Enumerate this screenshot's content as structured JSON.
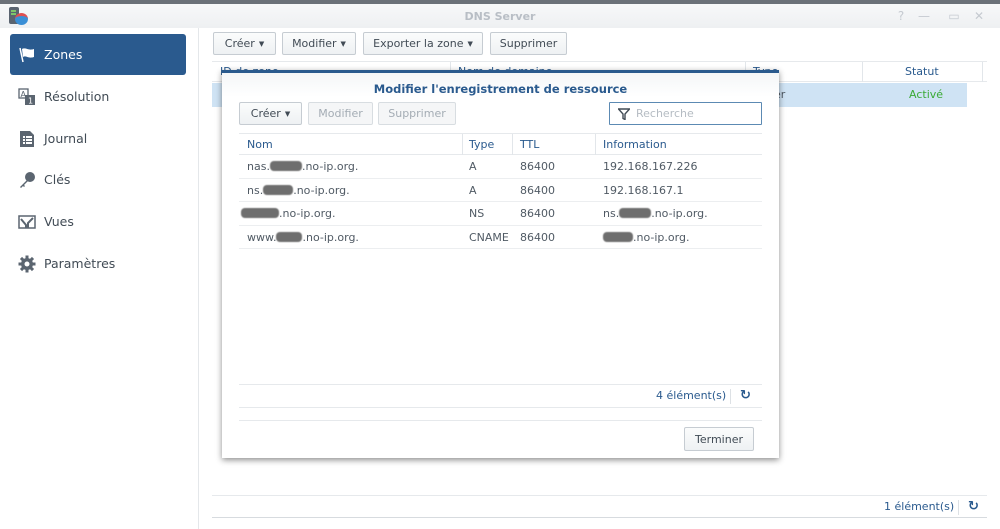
{
  "window": {
    "title": "DNS Server",
    "controls": {
      "help": "?",
      "minimize": "—",
      "maximize": "▭",
      "close": "✕"
    }
  },
  "sidebar": {
    "items": [
      {
        "label": "Zones",
        "icon": "flag-icon",
        "active": true
      },
      {
        "label": "Résolution",
        "icon": "resolution-icon",
        "active": false
      },
      {
        "label": "Journal",
        "icon": "log-icon",
        "active": false
      },
      {
        "label": "Clés",
        "icon": "key-icon",
        "active": false
      },
      {
        "label": "Vues",
        "icon": "views-icon",
        "active": false
      },
      {
        "label": "Paramètres",
        "icon": "gear-icon",
        "active": false
      }
    ]
  },
  "toolbar": {
    "create": "Créer",
    "modify": "Modifier",
    "export": "Exporter la zone",
    "delete": "Supprimer"
  },
  "zones_grid": {
    "columns": [
      "ID de zone",
      "Nom de domaine",
      "Type",
      "Statut"
    ],
    "rows": [
      {
        "type_partial": "er",
        "status": "Activé"
      }
    ],
    "status_color": "#3aaa35",
    "footer_count": "1 élément(s)"
  },
  "dialog": {
    "title": "Modifier l'enregistrement de ressource",
    "buttons": {
      "create": "Créer",
      "modify": "Modifier",
      "delete": "Supprimer"
    },
    "search_placeholder": "Recherche",
    "columns": [
      "Nom",
      "Type",
      "TTL",
      "Information"
    ],
    "records": [
      {
        "name_prefix": "nas.",
        "name_suffix": ".no-ip.org.",
        "type": "A",
        "ttl": "86400",
        "info_prefix": "192.168.167.226",
        "info_suffix": ""
      },
      {
        "name_prefix": "ns.",
        "name_suffix": ".no-ip.org.",
        "type": "A",
        "ttl": "86400",
        "info_prefix": "192.168.167.1",
        "info_suffix": ""
      },
      {
        "name_prefix": "",
        "name_suffix": ".no-ip.org.",
        "type": "NS",
        "ttl": "86400",
        "info_prefix": "ns.",
        "info_suffix": ".no-ip.org."
      },
      {
        "name_prefix": "www.",
        "name_suffix": ".no-ip.org.",
        "type": "CNAME",
        "ttl": "86400",
        "info_prefix": "",
        "info_suffix": ".no-ip.org."
      }
    ],
    "footer_count": "4 élément(s)",
    "finish": "Terminer"
  }
}
